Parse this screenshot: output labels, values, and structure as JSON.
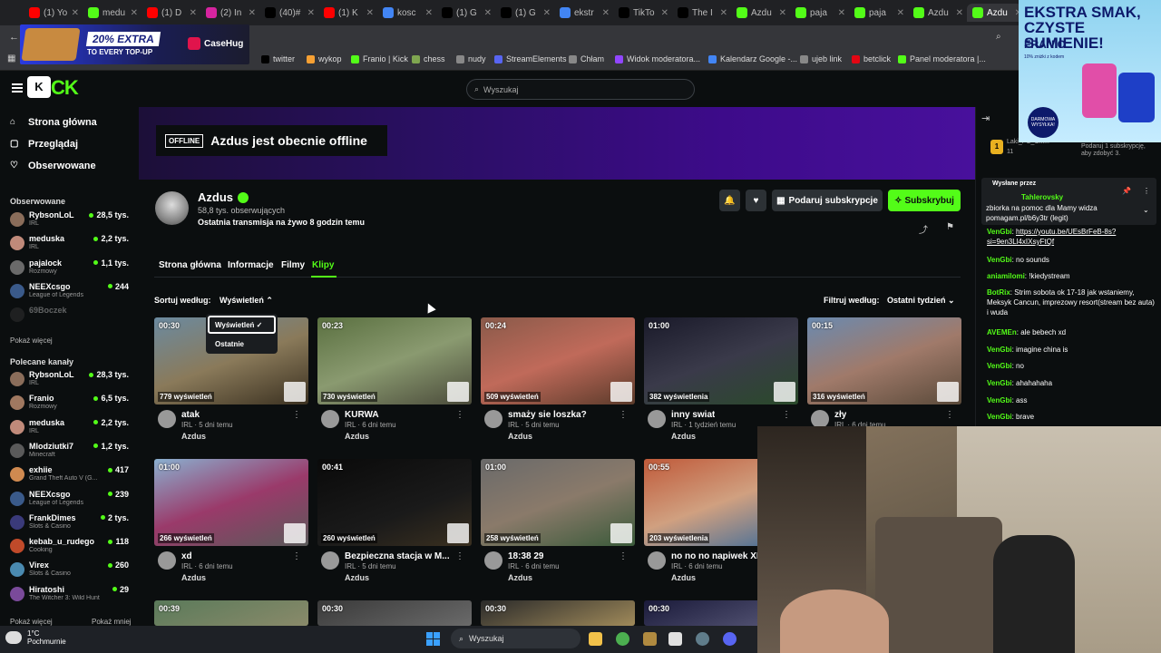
{
  "browser": {
    "tabs": [
      {
        "label": "(1) Yo",
        "color": "#ff0000"
      },
      {
        "label": "medu",
        "color": "#53fc18"
      },
      {
        "label": "(1) D",
        "color": "#ff0000"
      },
      {
        "label": "(2) In",
        "color": "#d6249f"
      },
      {
        "label": "(40)#",
        "color": "#000000"
      },
      {
        "label": "(1) K",
        "color": "#ff0000"
      },
      {
        "label": "kosc",
        "color": "#4285f4"
      },
      {
        "label": "(1) G",
        "color": "#000000"
      },
      {
        "label": "(1) G",
        "color": "#000000"
      },
      {
        "label": "ekstr",
        "color": "#4285f4"
      },
      {
        "label": "TikTo",
        "color": "#000000"
      },
      {
        "label": "The I",
        "color": "#000000"
      },
      {
        "label": "Azdu",
        "color": "#53fc18"
      },
      {
        "label": "paja",
        "color": "#53fc18"
      },
      {
        "label": "paja",
        "color": "#53fc18"
      },
      {
        "label": "Azdu",
        "color": "#53fc18"
      },
      {
        "label": "Azdu",
        "color": "#53fc18"
      }
    ],
    "bookmarks": [
      {
        "label": "twitter",
        "color": "#000000"
      },
      {
        "label": "wykop",
        "color": "#f6a033"
      },
      {
        "label": "Franio | Kick",
        "color": "#53fc18"
      },
      {
        "label": "chess",
        "color": "#7fa650"
      },
      {
        "label": "nudy",
        "color": "#888888"
      },
      {
        "label": "StreamElements",
        "color": "#5865f2"
      },
      {
        "label": "Chłam",
        "color": "#888888"
      },
      {
        "label": "Widok moderatora...",
        "color": "#9146ff"
      },
      {
        "label": "Kalendarz Google -...",
        "color": "#4285f4"
      },
      {
        "label": "ujeb link",
        "color": "#888888"
      },
      {
        "label": "betclick",
        "color": "#e30613"
      },
      {
        "label": "Panel moderatora |...",
        "color": "#53fc18"
      }
    ]
  },
  "ad_banner": {
    "pct": "20% EXTRA",
    "sub": "TO EVERY TOP-UP",
    "brand": "CaseHug"
  },
  "header": {
    "logo_a": "K",
    "logo_b": "CK",
    "search_placeholder": "Wyszukaj"
  },
  "sidebar": {
    "nav": [
      {
        "label": "Strona główna",
        "icon": "home-icon"
      },
      {
        "label": "Przeglądaj",
        "icon": "browse-icon"
      },
      {
        "label": "Obserwowane",
        "icon": "heart-icon"
      }
    ],
    "followed_title": "Obserwowane",
    "followed": [
      {
        "name": "RybsonLoL",
        "cat": "IRL",
        "views": "28,5 tys.",
        "color": "#8a6d5a"
      },
      {
        "name": "meduska",
        "cat": "IRL",
        "views": "2,2 tys.",
        "color": "#c08a7a"
      },
      {
        "name": "pajalock",
        "cat": "Rozmowy",
        "views": "1,1 tys.",
        "color": "#6a6a6a"
      },
      {
        "name": "NEEXcsgo",
        "cat": "League of Legends",
        "views": "244",
        "color": "#3a5a8a"
      },
      {
        "name": "69Boczek",
        "cat": "",
        "views": "",
        "color": "#444444"
      }
    ],
    "show_more": "Pokaż więcej",
    "recommended_title": "Polecane kanały",
    "recommended": [
      {
        "name": "RybsonLoL",
        "cat": "IRL",
        "views": "28,3 tys.",
        "color": "#8a6d5a"
      },
      {
        "name": "Franio",
        "cat": "Rozmowy",
        "views": "6,5 tys.",
        "color": "#a07860"
      },
      {
        "name": "meduska",
        "cat": "IRL",
        "views": "2,2 tys.",
        "color": "#c08a7a"
      },
      {
        "name": "Mlodziutki7",
        "cat": "Minecraft",
        "views": "1,2 tys.",
        "color": "#5a5a5a"
      },
      {
        "name": "exhiie",
        "cat": "Grand Theft Auto V (G...",
        "views": "417",
        "color": "#d08a50"
      },
      {
        "name": "NEEXcsgo",
        "cat": "League of Legends",
        "views": "239",
        "color": "#3a5a8a"
      },
      {
        "name": "FrankDimes",
        "cat": "Slots & Casino",
        "views": "2 tys.",
        "color": "#3a3a7a"
      },
      {
        "name": "kebab_u_rudego",
        "cat": "Cooking",
        "views": "118",
        "color": "#c04a2a"
      },
      {
        "name": "Virex",
        "cat": "Slots & Casino",
        "views": "260",
        "color": "#4a8ab0"
      },
      {
        "name": "Hiratoshi",
        "cat": "The Witcher 3: Wild Hunt",
        "views": "29",
        "color": "#7a4a9a"
      }
    ],
    "show_more2": "Pokaż więcej",
    "show_less": "Pokaż mniej"
  },
  "channel": {
    "offline_badge": "OFFLINE",
    "offline_text": "Azdus jest obecnie offline",
    "name": "Azdus",
    "followers": "58,8 tys. obserwujących",
    "last_stream": "Ostatnia transmisja na żywo 8 godzin temu",
    "gift_label": "Podaruj subskrypcje",
    "sub_label": "Subskrybuj",
    "tabs": [
      "Strona główna",
      "Informacje",
      "Filmy",
      "Klipy"
    ],
    "sort_label": "Sortuj według:",
    "sort_value": "Wyświetleń",
    "filter_label": "Filtruj według:",
    "filter_value": "Ostatni tydzień",
    "dropdown": [
      "Wyświetleń",
      "Ostatnie"
    ]
  },
  "clips": [
    {
      "dur": "00:30",
      "views": "779 wyświetleń",
      "title": "atak",
      "meta": "IRL · 5 dni temu",
      "author": "Azdus",
      "bg": "linear-gradient(160deg,#6b8aa0,#8a7a5a 50%,#3a3020)"
    },
    {
      "dur": "00:23",
      "views": "730 wyświetleń",
      "title": "KURWA",
      "meta": "IRL · 6 dni temu",
      "author": "Azdus",
      "bg": "linear-gradient(160deg,#5a7040,#8a9a70 50%,#4a4a3a)"
    },
    {
      "dur": "00:24",
      "views": "509 wyświetleń",
      "title": "smaży sie loszka?",
      "meta": "IRL · 5 dni temu",
      "author": "Azdus",
      "bg": "linear-gradient(160deg,#8a5a4a,#c06a5a 50%,#5a3a2a)"
    },
    {
      "dur": "01:00",
      "views": "382 wyświetlenia",
      "title": "inny swiat",
      "meta": "IRL · 1 tydzień temu",
      "author": "Azdus",
      "bg": "linear-gradient(160deg,#1a1a2a,#3a3a4a 50%,#2a4a2a)"
    },
    {
      "dur": "00:15",
      "views": "316 wyświetleń",
      "title": "zły",
      "meta": "IRL · 6 dni temu",
      "author": "Azdus",
      "bg": "linear-gradient(160deg,#6a8ab0,#a07a6a 50%,#5a4a3a)"
    },
    {
      "dur": "01:00",
      "views": "266 wyświetleń",
      "title": "xd",
      "meta": "IRL · 6 dni temu",
      "author": "Azdus",
      "bg": "linear-gradient(160deg,#8ab0d0,#9a3a6a 50%,#5a5a5a)"
    },
    {
      "dur": "00:41",
      "views": "260 wyświetleń",
      "title": "Bezpieczna stacja w M...",
      "meta": "IRL · 5 dni temu",
      "author": "Azdus",
      "bg": "linear-gradient(160deg,#0a0a0a,#1a1a1a 60%,#3a3020)"
    },
    {
      "dur": "01:00",
      "views": "258 wyświetleń",
      "title": "18:38 29",
      "meta": "IRL · 6 dni temu",
      "author": "Azdus",
      "bg": "linear-gradient(160deg,#6a6a6a,#8a7a6a 50%,#3a5a3a)"
    },
    {
      "dur": "00:55",
      "views": "203 wyświetlenia",
      "title": "no no no napiwek XD",
      "meta": "IRL · 6 dni temu",
      "author": "Azdus",
      "bg": "linear-gradient(160deg,#c05a3a,#d0a080 50%,#3a6a9a)"
    },
    {
      "dur": "00:39",
      "views": "",
      "title": "",
      "meta": "",
      "author": "",
      "bg": "linear-gradient(160deg,#5a7a5a,#8a8a6a)"
    },
    {
      "dur": "00:30",
      "views": "",
      "title": "",
      "meta": "",
      "author": "",
      "bg": "linear-gradient(160deg,#3a3a3a,#6a6a6a)"
    },
    {
      "dur": "00:30",
      "views": "",
      "title": "",
      "meta": "",
      "author": "",
      "bg": "linear-gradient(160deg,#2a2a2a,#a08a5a)"
    },
    {
      "dur": "00:30",
      "views": "",
      "title": "",
      "meta": "",
      "author": "",
      "bg": "linear-gradient(160deg,#1a1a3a,#5a5a7a)"
    }
  ],
  "chat": {
    "goal_user": "Laki_PC_Offi...",
    "goal_count": "11",
    "goal_text": "Podaruj 1 subskrypcję, aby zdobyć 3.",
    "pinned_by": "Wysłane przez",
    "pinned_user": "Tahlerovsky",
    "pinned_msg": "zbiorka na pomoc dla Mamy widza pomagam.pl/b6y3tr (legit)",
    "messages": [
      {
        "user": "VenGbi",
        "text": "https://youtu.be/UEsBrFeB-8s?si=9en3Ll4xIXsyFtQf",
        "link": true
      },
      {
        "user": "VenGbi",
        "text": "no sounds",
        "link": false
      },
      {
        "user": "aniamilomi",
        "text": "!kiedystream",
        "link": false
      },
      {
        "user": "BotRix",
        "text": "Strim sobota ok 17-18 jak wstaniemy, Meksyk Cancun, imprezowy resort(stream bez auta) i wuda",
        "link": false
      },
      {
        "user": "AVEMEn",
        "text": "ale bebech xd",
        "link": false
      },
      {
        "user": "VenGbi",
        "text": "imagine china is",
        "link": false
      },
      {
        "user": "VenGbi",
        "text": "no",
        "link": false
      },
      {
        "user": "VenGbi",
        "text": "ahahahaha",
        "link": false
      },
      {
        "user": "VenGbi",
        "text": "ass",
        "link": false
      },
      {
        "user": "VenGbi",
        "text": "brave",
        "link": false
      }
    ]
  },
  "ad_right": {
    "line1": "EKSTRA SMAK,",
    "line2": "CZYSTE SUMIENIE!",
    "brand": "FRANIO",
    "fine": "10% zniżki z kodem",
    "badge": "DARMOWA WYSYŁKA!"
  },
  "taskbar": {
    "temp": "1°C",
    "weather": "Pochmurnie",
    "search": "Wyszukaj"
  }
}
